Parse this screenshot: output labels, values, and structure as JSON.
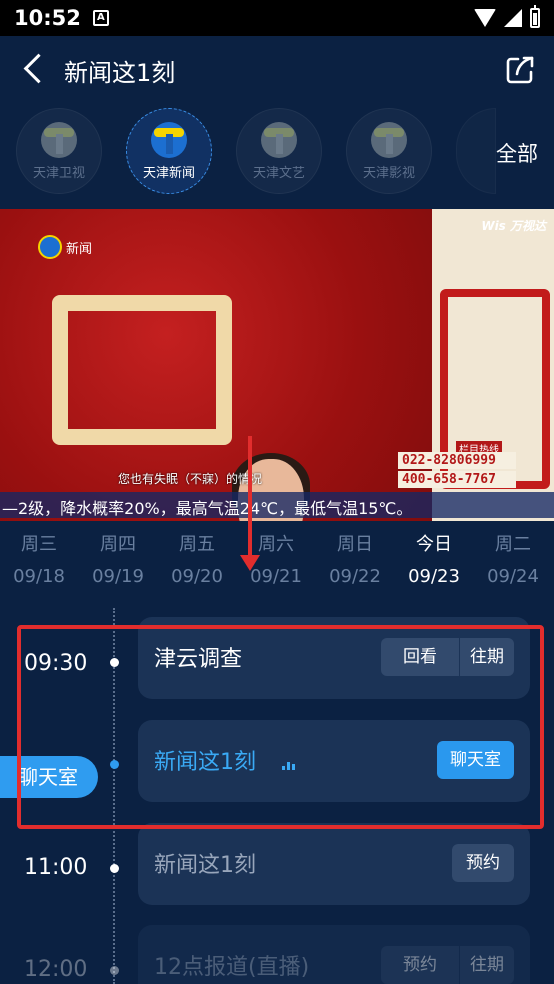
{
  "status_bar": {
    "time": "10:52",
    "notif_glyph": "A"
  },
  "nav": {
    "title": "新闻这1刻"
  },
  "channels": {
    "items": [
      {
        "name": "天津卫视",
        "badge": ""
      },
      {
        "name": "天津新闻",
        "badge": "1"
      },
      {
        "name": "天津文艺",
        "badge": "2"
      },
      {
        "name": "天津影视",
        "badge": "3"
      }
    ],
    "all_label": "全部"
  },
  "video": {
    "channel_logo_text": "新闻",
    "wis_logo": "Wis 万视达",
    "caption": "您也有失眠（不寐）的情况",
    "hotline_label": "栏目热线",
    "hotlines": [
      "022-82806999",
      "400-658-7767"
    ],
    "ticker": "—2级，降水概率20%，最高气温24℃，最低气温15℃。"
  },
  "dates": [
    {
      "day": "周三",
      "date": "09/18",
      "active": false
    },
    {
      "day": "周四",
      "date": "09/19",
      "active": false
    },
    {
      "day": "周五",
      "date": "09/20",
      "active": false
    },
    {
      "day": "周六",
      "date": "09/21",
      "active": false
    },
    {
      "day": "周日",
      "date": "09/22",
      "active": false
    },
    {
      "day": "今日",
      "date": "09/23",
      "active": true
    },
    {
      "day": "周二",
      "date": "09/24",
      "active": false
    }
  ],
  "schedule": [
    {
      "time": "09:30",
      "title": "津云调查",
      "state": "past",
      "buttons": [
        "回看",
        "往期"
      ]
    },
    {
      "time": "",
      "title": "新闻这1刻",
      "state": "live",
      "buttons": [
        "聊天室"
      ]
    },
    {
      "time": "11:00",
      "title": "新闻这1刻",
      "state": "upcoming",
      "buttons": [
        "预约"
      ]
    },
    {
      "time": "12:00",
      "title": "12点报道(直播)",
      "state": "upcoming",
      "buttons": [
        "预约",
        "往期"
      ]
    }
  ],
  "chat_pill": "聊天室",
  "colors": {
    "background": "#0b2142",
    "accent": "#2f9cf0",
    "card": "#1b3356",
    "highlight": "#e22d2d"
  }
}
